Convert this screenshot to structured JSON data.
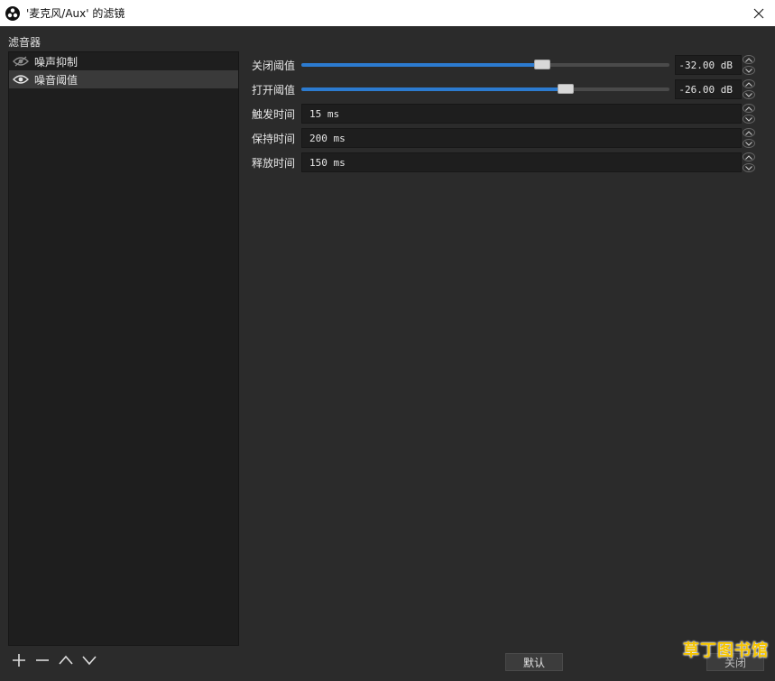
{
  "window": {
    "title": "'麦克风/Aux' 的滤镜",
    "close_label": "✕"
  },
  "filters": {
    "heading": "滤音器",
    "items": [
      {
        "label": "噪声抑制",
        "visible": false
      },
      {
        "label": "噪音阈值",
        "visible": true,
        "selected": true
      }
    ]
  },
  "properties": {
    "close_threshold": {
      "label": "关闭阈值",
      "value": "-32.00 dB",
      "slider_fraction": 0.655
    },
    "open_threshold": {
      "label": "打开阈值",
      "value": "-26.00 dB",
      "slider_fraction": 0.718
    },
    "attack_time": {
      "label": "触发时间",
      "value": "15 ms"
    },
    "hold_time": {
      "label": "保持时间",
      "value": "200 ms"
    },
    "release_time": {
      "label": "释放时间",
      "value": "150 ms"
    }
  },
  "footer": {
    "reset_label": "默认",
    "close_label": "关闭"
  },
  "watermark": "草丁图书馆",
  "colors": {
    "accent": "#2c7bd0",
    "background": "#2b2b2b",
    "panel": "#1e1e1e",
    "watermark": "#f5c400"
  }
}
